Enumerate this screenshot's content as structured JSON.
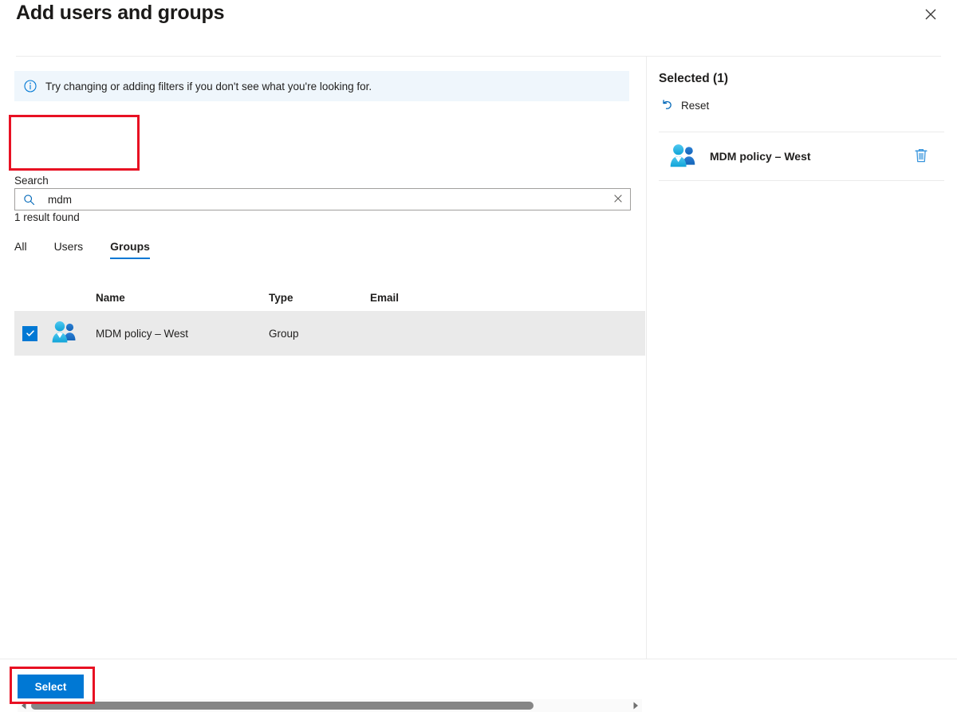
{
  "dialog": {
    "title": "Add users and groups",
    "close_icon": "close-icon"
  },
  "info_bar": {
    "icon": "info-circle-icon",
    "message": "Try changing or adding filters if you don't see what you're looking for."
  },
  "search": {
    "label": "Search",
    "value": "mdm",
    "placeholder": "Search",
    "icon": "search-icon",
    "clear_icon": "clear-icon",
    "result_count": "1 result found"
  },
  "tabs": [
    {
      "label": "All",
      "selected": false
    },
    {
      "label": "Users",
      "selected": false
    },
    {
      "label": "Groups",
      "selected": true
    }
  ],
  "table": {
    "columns": [
      "Name",
      "Type",
      "Email"
    ],
    "rows": [
      {
        "checked": true,
        "icon": "group-people-icon",
        "name": "MDM policy – West",
        "type": "Group",
        "email": ""
      }
    ]
  },
  "scrollbar": {
    "left_arrow": "chevron-left-icon",
    "right_arrow": "chevron-right-icon"
  },
  "selected_panel": {
    "heading": "Selected (1)",
    "reset_label": "Reset",
    "reset_icon": "undo-arrow-icon",
    "items": [
      {
        "icon": "group-people-icon",
        "name": "MDM policy – West",
        "delete_icon": "trash-icon"
      }
    ]
  },
  "footer": {
    "select_label": "Select"
  },
  "colors": {
    "accent": "#0078d4",
    "annotation": "#e81123",
    "info_bar_bg": "#eff6fc",
    "row_selected_bg": "#eaeaea"
  }
}
